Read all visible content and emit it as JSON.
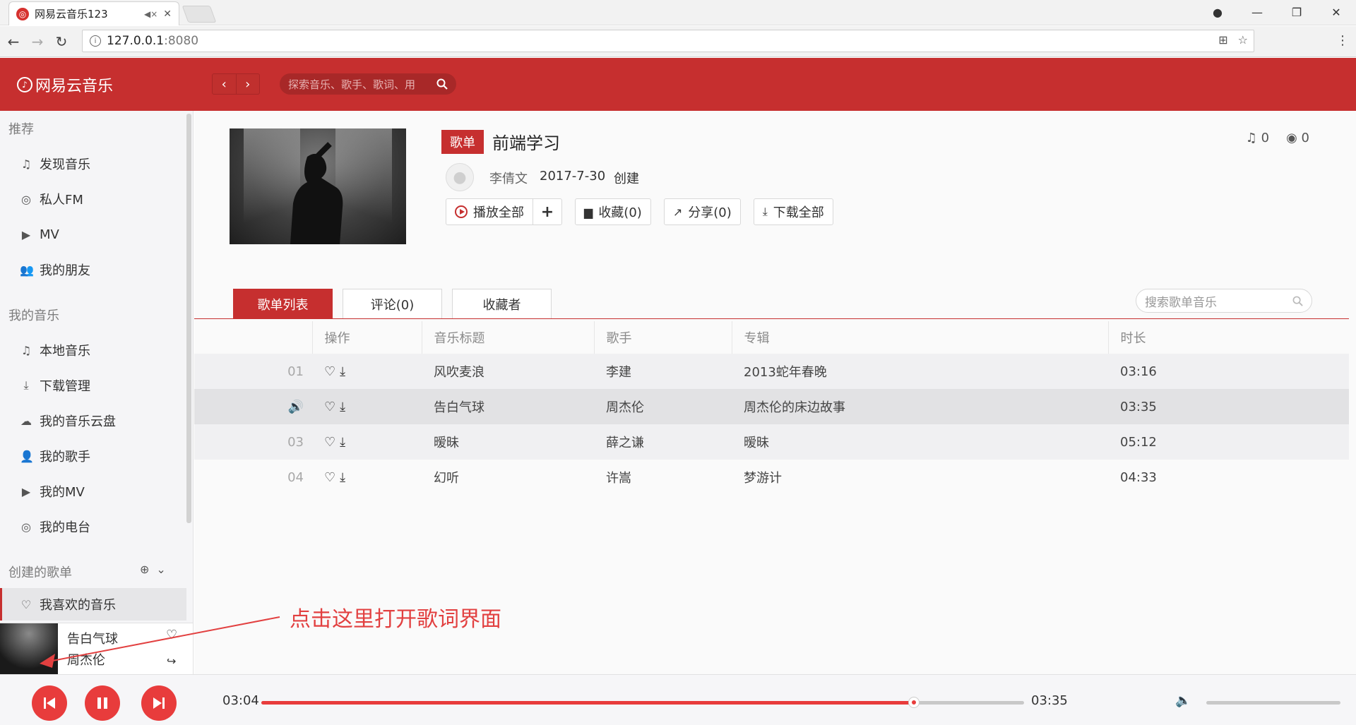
{
  "browser": {
    "tab_title": "网易云音乐123",
    "url_host": "127.0.0.1",
    "url_port": ":8080",
    "window_controls": {
      "account": "●",
      "minimize": "—",
      "maximize": "❐",
      "close": "✕"
    }
  },
  "header": {
    "logo_text": "网易云音乐",
    "search_placeholder": "探索音乐、歌手、歌词、用",
    "back": "‹",
    "forward": "›"
  },
  "sidebar": {
    "section_recommend": "推荐",
    "recommend_items": [
      {
        "label": "发现音乐",
        "icon": "music-note-icon"
      },
      {
        "label": "私人FM",
        "icon": "radio-icon"
      },
      {
        "label": "MV",
        "icon": "video-icon"
      },
      {
        "label": "我的朋友",
        "icon": "friends-icon"
      }
    ],
    "section_my_music": "我的音乐",
    "my_music_items": [
      {
        "label": "本地音乐",
        "icon": "music-note-icon"
      },
      {
        "label": "下载管理",
        "icon": "download-icon"
      },
      {
        "label": "我的音乐云盘",
        "icon": "cloud-icon"
      },
      {
        "label": "我的歌手",
        "icon": "singer-icon"
      },
      {
        "label": "我的MV",
        "icon": "video-icon"
      },
      {
        "label": "我的电台",
        "icon": "radio-icon"
      }
    ],
    "section_created": "创建的歌单",
    "created_items": [
      {
        "label": "我喜欢的音乐",
        "icon": "heart-icon"
      }
    ]
  },
  "mini_player": {
    "song": "告白气球",
    "artist": "周杰伦"
  },
  "playlist": {
    "badge": "歌单",
    "title": "前端学习",
    "creator": "李倩文",
    "date": "2017-7-30",
    "created_verb": "创建",
    "song_count": "0",
    "play_count": "0",
    "actions": {
      "play_all": "播放全部",
      "add": "+",
      "collect": "收藏(0)",
      "share": "分享(0)",
      "download_all": "下载全部"
    }
  },
  "tabs": {
    "list": "歌单列表",
    "comments": "评论(0)",
    "collectors": "收藏者",
    "search_placeholder": "搜索歌单音乐"
  },
  "table": {
    "headers": {
      "ops": "操作",
      "title": "音乐标题",
      "artist": "歌手",
      "album": "专辑",
      "duration": "时长"
    },
    "rows": [
      {
        "num": "01",
        "title": "风吹麦浪",
        "artist": "李建",
        "album": "2013蛇年春晚",
        "duration": "03:16"
      },
      {
        "num": "",
        "title": "告白气球",
        "artist": "周杰伦",
        "album": "周杰伦的床边故事",
        "duration": "03:35"
      },
      {
        "num": "03",
        "title": "暧昧",
        "artist": "薛之谦",
        "album": "暧昧",
        "duration": "05:12"
      },
      {
        "num": "04",
        "title": "幻听",
        "artist": "许嵩",
        "album": "梦游计",
        "duration": "04:33"
      }
    ]
  },
  "annotation": "点击这里打开歌词界面",
  "player": {
    "current_time": "03:04",
    "total_time": "03:35",
    "progress": 0.856,
    "volume": 0
  },
  "colors": {
    "brand": "#c62f2f",
    "accent": "#e83c3c"
  }
}
